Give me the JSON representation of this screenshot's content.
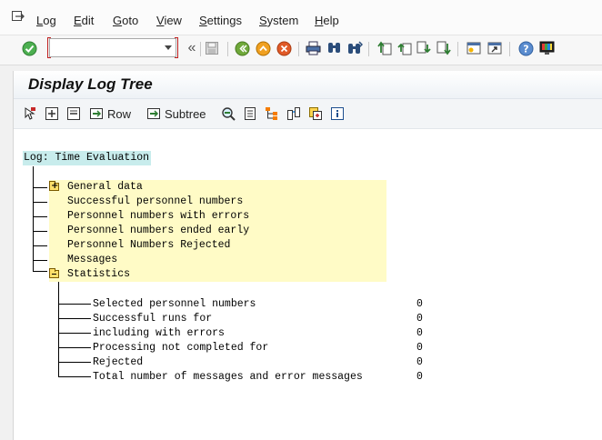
{
  "menu": {
    "items": [
      {
        "label": "Log"
      },
      {
        "label": "Edit"
      },
      {
        "label": "Goto"
      },
      {
        "label": "View"
      },
      {
        "label": "Settings"
      },
      {
        "label": "System"
      },
      {
        "label": "Help"
      }
    ]
  },
  "toolbar": {
    "command_field": {
      "value": "",
      "placeholder": ""
    },
    "icons": [
      "enter-icon",
      "collapse-icon",
      "save-icon",
      "back-icon",
      "exit-icon",
      "cancel-icon",
      "print-icon",
      "find-icon",
      "find-next-icon",
      "first-page-icon",
      "previous-page-icon",
      "next-page-icon",
      "last-page-icon",
      "create-session-icon",
      "shortcut-icon",
      "help-icon",
      "customize-layout-icon"
    ]
  },
  "screen": {
    "title": "Display Log Tree",
    "app_toolbar": {
      "row_label": "Row",
      "subtree_label": "Subtree"
    }
  },
  "tree": {
    "root": "Log: Time Evaluation",
    "nodes": [
      {
        "label": "General data",
        "folder": "closed"
      },
      {
        "label": "Successful personnel numbers"
      },
      {
        "label": "Personnel numbers with errors"
      },
      {
        "label": "Personnel numbers ended early"
      },
      {
        "label": "Personnel Numbers Rejected"
      },
      {
        "label": "Messages"
      },
      {
        "label": "Statistics",
        "folder": "open"
      }
    ],
    "statistics": [
      {
        "label": "Selected personnel numbers",
        "value": "0"
      },
      {
        "label": "Successful runs for",
        "value": "0"
      },
      {
        "label": "including with errors",
        "value": "0"
      },
      {
        "label": "Processing not completed for",
        "value": "0"
      },
      {
        "label": "Rejected",
        "value": "0"
      },
      {
        "label": "Total number of messages and error messages",
        "value": "0"
      }
    ]
  }
}
